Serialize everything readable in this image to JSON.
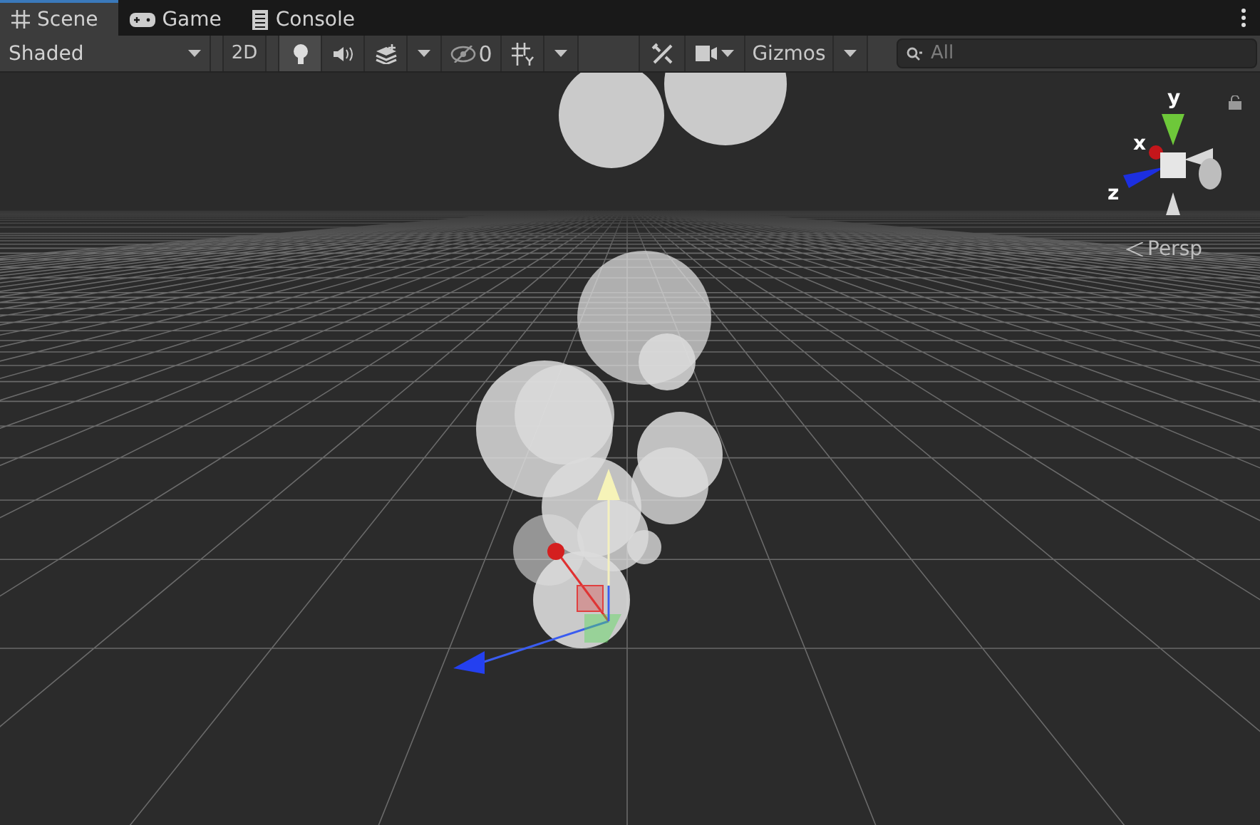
{
  "tabs": [
    {
      "kind": "scene",
      "label": "Scene",
      "selected": true
    },
    {
      "kind": "game",
      "label": "Game",
      "selected": false
    },
    {
      "kind": "console",
      "label": "Console",
      "selected": false
    }
  ],
  "toolbar": {
    "shading": "Shaded",
    "mode_2d": {
      "label": "2D",
      "selected": false
    },
    "toggles": [
      {
        "kind": "lighting",
        "selected": true
      },
      {
        "kind": "audio",
        "selected": false
      },
      {
        "kind": "effects",
        "selected": false
      }
    ],
    "hidden_count": "0",
    "gizmos": "Gizmos",
    "search": {
      "placeholder": "All"
    }
  },
  "viewport": {
    "axes": {
      "y": "y",
      "x": "x",
      "z": "z"
    },
    "projection": "Persp"
  }
}
